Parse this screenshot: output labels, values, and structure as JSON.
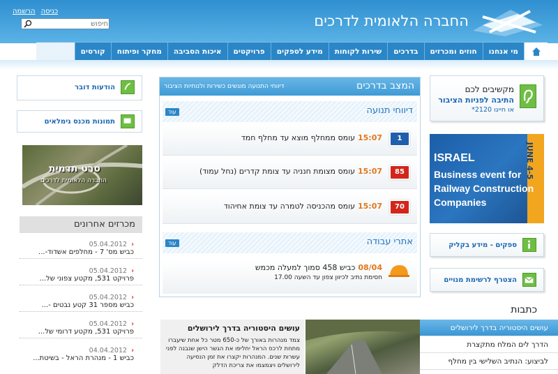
{
  "header": {
    "site_title": "החברה הלאומית לדרכים",
    "links": {
      "register": "הרשמה",
      "login": "כניסה"
    },
    "search_placeholder": "חיפוש"
  },
  "nav": {
    "items": [
      "מי אנחנו",
      "חוזים ומכרזים",
      "בדרכים",
      "שירות לקוחות",
      "מידע לספקים",
      "פרויקטים",
      "איכות הסביבה",
      "מחקר ופיתוח",
      "קורסים"
    ]
  },
  "left": {
    "spokesman": "הודעות דובר",
    "gimalaim": "תמונות מכנס גימלאים",
    "banner": {
      "title": "סרט תדמית",
      "subtitle": "החברה הלאומית לדרכים"
    },
    "recent_title": "מכרזים אחרונים",
    "recent": [
      {
        "date": "05.04.2012",
        "text": "כביש מס' 7 - מחלפים אשדוד-..."
      },
      {
        "date": "05.04.2012",
        "text": "פרויקט 531, מקטע צפוני של..."
      },
      {
        "date": "05.04.2012",
        "text": "כביש מספר 31 קטע נבטים -..."
      },
      {
        "date": "05.04.2012",
        "text": "פרויקט 531, מקטע דרומי של..."
      },
      {
        "date": "04.04.2012",
        "text": "כביש 1 - מנהרת הראל - בשיטת..."
      }
    ]
  },
  "center": {
    "title": "המצב בדרכים",
    "subtitle": "דיווחי התנועה מוגשים כשירות ולנוחיות הציבור",
    "traffic_title": "דיווחי תנועה",
    "more": "עוד",
    "reports": [
      {
        "time": "15:07",
        "text": "עומס ממחלף מוצא עד מחלף חמד",
        "sign": "1",
        "color": "#1f5fae"
      },
      {
        "time": "15:07",
        "text": "עומס מצומת חנניה עד צומת קדרים (נחל עמוד)",
        "sign": "85",
        "color": "#d2261c"
      },
      {
        "time": "15:07",
        "text": "עומס מהכניסה לטמרה עד צומת אחיהוד",
        "sign": "70",
        "color": "#d2261c"
      }
    ],
    "work_title": "אתרי עבודה",
    "work": {
      "date": "08/04",
      "line1": "כביש 458 סמוך למעלה מכמש",
      "line2": "חסימת נתיב לכיוון צפון עד השעה 17.00"
    }
  },
  "right": {
    "listen": {
      "l1": "מקשיבים לכם",
      "l2": "התיבה לפניות הציבור",
      "l3": "או חייגו 2120*"
    },
    "banner": {
      "date": "JUNE 4-5",
      "country": "ISRAEL",
      "lines": [
        "Business event for",
        "Railway Construction",
        "Companies"
      ]
    },
    "suppliers": "ספקים - מידע בקליק",
    "subscribe": "הצטרף לרשימת מנויים"
  },
  "articles": {
    "title": "כתבות",
    "feature": {
      "headline": "עושים היסטוריה בדרך לירושלים",
      "body": "צמד מנהרות באורך של כ-650 מטר כל אחת שיעברו מתחת לרכס הראל יחליפו את הגשר הישן שנבנה לפני עשרות שנים. המנהרות יקצרו את זמן הנסיעה לירושלים ויצמצמו את צריכת הדלק"
    },
    "list": [
      "עושים היסטוריה בדרך לירושלים",
      "הדרך לים המלח מתקצרת",
      "לביצוע: הנתיב השלישי בין מחלף"
    ]
  }
}
